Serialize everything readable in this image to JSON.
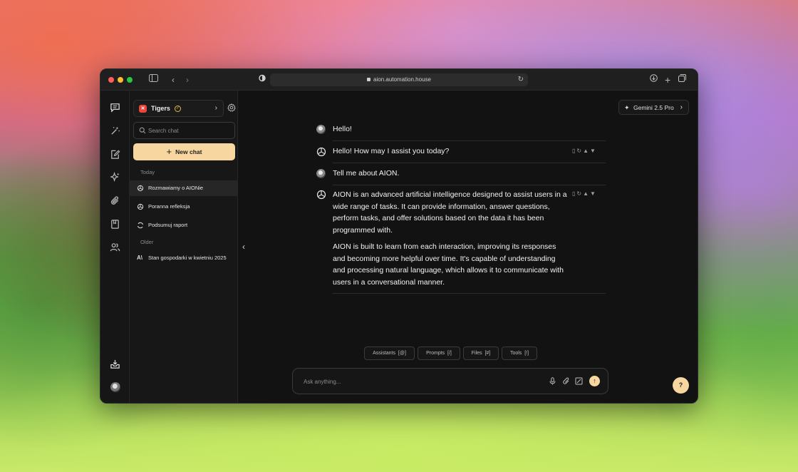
{
  "browser": {
    "url": "aion.automation.house",
    "traffic_colors": [
      "#ff5f57",
      "#febc2e",
      "#28c840"
    ]
  },
  "rail": {
    "icons": [
      "chat-icon",
      "magic-wand-icon",
      "edit-note-icon",
      "sparkles-icon",
      "paperclip-icon",
      "book-icon",
      "users-icon",
      "download-tray-icon"
    ]
  },
  "sidebar": {
    "team_name": "Tigers",
    "team_badge": "✕",
    "search_placeholder": "Search chat",
    "new_chat_label": "New chat",
    "today_label": "Today",
    "older_label": "Older",
    "today_items": [
      {
        "label": "Rozmawiamy o AIONie",
        "icon": "openai-icon"
      },
      {
        "label": "Poranna refleksja",
        "icon": "openai-icon"
      },
      {
        "label": "Podsumuj raport",
        "icon": "refresh-loop-icon"
      }
    ],
    "older_items": [
      {
        "label": "Stan gospodarki w kwietniu 2025",
        "icon": "anthropic-icon"
      }
    ]
  },
  "main": {
    "model_label": "Gemini 2.5 Pro",
    "messages": [
      {
        "role": "user",
        "text": "Hello!"
      },
      {
        "role": "assistant",
        "text": "Hello! How may I assist you today?"
      },
      {
        "role": "user",
        "text": "Tell me about AION."
      },
      {
        "role": "assistant",
        "paragraph1": "AION is an advanced artificial intelligence designed to assist users in a wide range of tasks. It can provide information, answer questions, perform tasks, and offer solutions based on the data it has been programmed with.",
        "paragraph2": "AION is built to learn from each interaction, improving its responses and becoming more helpful over time. It's capable of understanding and processing natural language, which allows it to communicate with users in a conversational manner."
      }
    ],
    "chips": [
      {
        "label": "Assistants",
        "shortcut": "[@]"
      },
      {
        "label": "Prompts",
        "shortcut": "[/]"
      },
      {
        "label": "Files",
        "shortcut": "[#]"
      },
      {
        "label": "Tools",
        "shortcut": "[!]"
      }
    ],
    "composer_placeholder": "Ask anything...",
    "help_label": "?"
  },
  "colors": {
    "accent": "#f8d6a0",
    "team_badge": "#e8453c"
  }
}
